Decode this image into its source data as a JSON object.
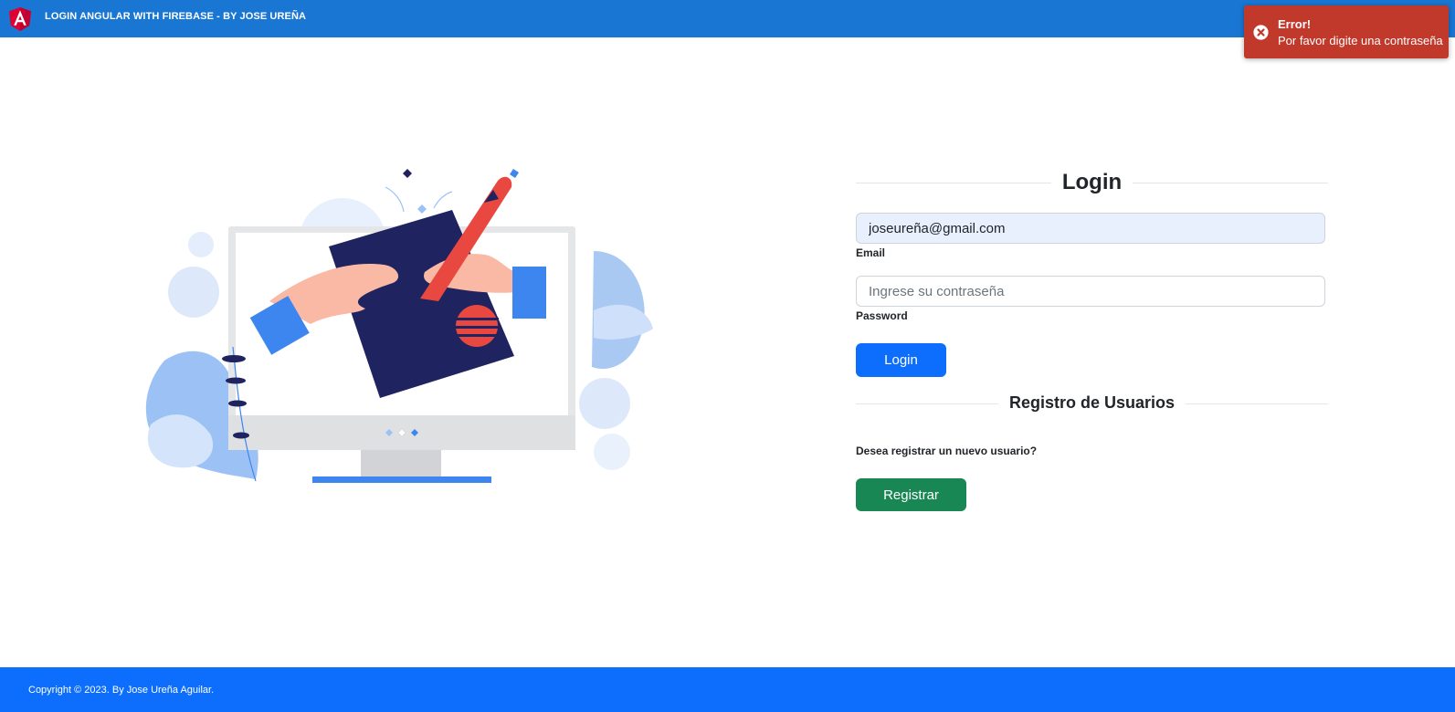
{
  "navbar": {
    "title": "LOGIN ANGULAR WITH FIREBASE - BY JOSE UREÑA",
    "logo_icon": "angular-logo-icon",
    "background": "#1976d2"
  },
  "toast": {
    "title": "Error!",
    "message": "Por favor digite una contraseña",
    "icon": "close-circle-icon",
    "background": "#c0392b"
  },
  "illustration": {
    "icon": "computer-drawing-illustration"
  },
  "login": {
    "heading": "Login",
    "email_value": "joseureña@gmail.com",
    "email_label": "Email",
    "password_placeholder": "Ingrese su contraseña",
    "password_label": "Password",
    "login_button": "Login",
    "button_color": "#0d6efd"
  },
  "register": {
    "heading": "Registro de Usuarios",
    "question": "Desea registrar un nuevo usuario?",
    "register_button": "Registrar",
    "button_color": "#198754"
  },
  "footer": {
    "text": "Copyright © 2023. By Jose Ureña Aguilar.",
    "background": "#0d6efd"
  }
}
